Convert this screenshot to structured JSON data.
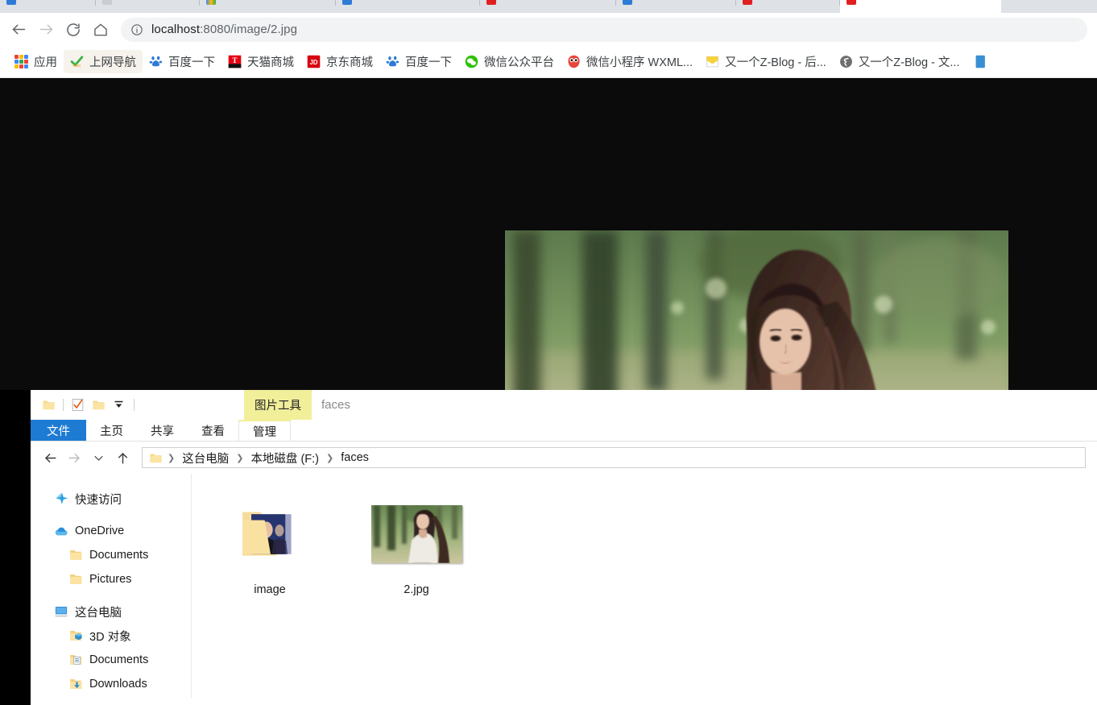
{
  "browser": {
    "tabs": [
      {
        "label": "",
        "active": false
      },
      {
        "label": "",
        "active": false
      },
      {
        "label": "",
        "active": false
      },
      {
        "label": "",
        "active": false
      },
      {
        "label": "",
        "active": false
      },
      {
        "label": "",
        "active": false
      },
      {
        "label": "",
        "active": false
      },
      {
        "label": "",
        "active": true
      }
    ],
    "nav": {
      "back": "back-arrow",
      "forward": "forward-arrow",
      "reload": "reload-icon",
      "home": "home-icon"
    },
    "omnibox": {
      "info_icon": "info-circle-icon",
      "url_host": "localhost",
      "url_path": ":8080/image/2.jpg",
      "url_full": "localhost:8080/image/2.jpg"
    },
    "bookmarks": [
      {
        "label": "应用",
        "icon": "apps-grid-icon",
        "chip": false
      },
      {
        "label": "上网导航",
        "icon": "hao123-icon",
        "chip": true
      },
      {
        "label": "百度一下",
        "icon": "baidu-icon",
        "chip": false
      },
      {
        "label": "天猫商城",
        "icon": "tmall-icon",
        "chip": false
      },
      {
        "label": "京东商城",
        "icon": "jd-icon",
        "chip": false
      },
      {
        "label": "百度一下",
        "icon": "baidu-icon",
        "chip": false
      },
      {
        "label": "微信公众平台",
        "icon": "wechat-icon",
        "chip": false
      },
      {
        "label": "微信小程序 WXML...",
        "icon": "wxml-owl-icon",
        "chip": false
      },
      {
        "label": "又一个Z-Blog - 后...",
        "icon": "zblog-admin-icon",
        "chip": false
      },
      {
        "label": "又一个Z-Blog - 文...",
        "icon": "zblog-globe-icon",
        "chip": false
      },
      {
        "label": "",
        "icon": "partial-bookmark-icon",
        "chip": false
      }
    ]
  },
  "page": {
    "background_color": "#0b0b0b",
    "image_alt": "2.jpg"
  },
  "explorer": {
    "quick_access_toolbar": [
      {
        "name": "folder-icon"
      },
      {
        "name": "properties-checkmark-icon"
      },
      {
        "name": "new-folder-icon"
      },
      {
        "name": "customize-dropdown-icon"
      }
    ],
    "contextual_tab_group": "图片工具",
    "window_title": "faces",
    "ribbon_tabs": [
      {
        "label": "文件",
        "active": true
      },
      {
        "label": "主页",
        "active": false
      },
      {
        "label": "共享",
        "active": false
      },
      {
        "label": "查看",
        "active": false
      },
      {
        "label": "管理",
        "active": false,
        "contextual": true
      }
    ],
    "address_bar": {
      "back": "back-arrow",
      "forward": "forward-arrow",
      "recent": "chevron-down-icon",
      "up": "up-arrow",
      "breadcrumbs": [
        "这台电脑",
        "本地磁盘 (F:)",
        "faces"
      ]
    },
    "nav_pane": [
      {
        "label": "快速访问",
        "icon": "quick-access-star-icon",
        "level": 0
      },
      {
        "label": "OneDrive",
        "icon": "onedrive-cloud-icon",
        "level": 0
      },
      {
        "label": "Documents",
        "icon": "folder-icon",
        "level": 1
      },
      {
        "label": "Pictures",
        "icon": "folder-icon",
        "level": 1
      },
      {
        "label": "这台电脑",
        "icon": "this-pc-monitor-icon",
        "level": 0
      },
      {
        "label": "3D 对象",
        "icon": "3d-objects-icon",
        "level": 1
      },
      {
        "label": "Documents",
        "icon": "documents-folder-icon",
        "level": 1
      },
      {
        "label": "Downloads",
        "icon": "downloads-folder-icon",
        "level": 1
      }
    ],
    "files": [
      {
        "label": "image",
        "type": "folder"
      },
      {
        "label": "2.jpg",
        "type": "image"
      }
    ]
  },
  "colors": {
    "accent_blue": "#1e7bd3",
    "contextual_yellow": "#f2ef9b",
    "chrome_grey": "#dee1e6",
    "omnibox_grey": "#f1f3f4"
  }
}
